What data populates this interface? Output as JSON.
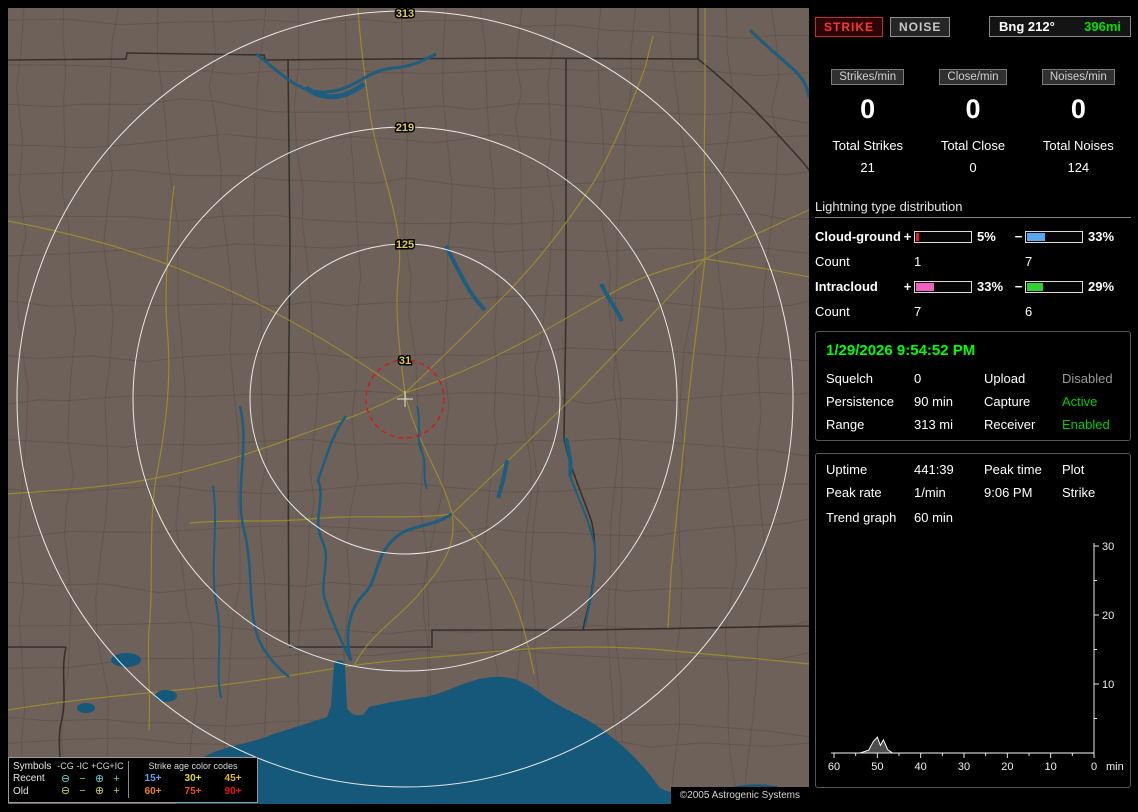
{
  "map": {
    "ring_labels": [
      "31",
      "125",
      "219",
      "313"
    ],
    "copyright": "©2005 Astrogenic Systems",
    "legend": {
      "symbols_header": "Symbols",
      "column_headers": [
        "-CG",
        "-IC",
        "+CG",
        "+IC"
      ],
      "age_header": "Strike age color codes",
      "rows": [
        {
          "label": "Recent",
          "symbols": [
            "⊖",
            "−",
            "⊕",
            "+"
          ],
          "symbol_color": "#5fd3cb",
          "ages": [
            {
              "label": "15+",
              "color": "#6a9ce8"
            },
            {
              "label": "30+",
              "color": "#d8d838"
            },
            {
              "label": "45+",
              "color": "#e8b030"
            }
          ]
        },
        {
          "label": "Old",
          "symbols": [
            "⊖",
            "−",
            "⊕",
            "+"
          ],
          "symbol_color": "#cfcf45",
          "ages": [
            {
              "label": "60+",
              "color": "#f08020"
            },
            {
              "label": "75+",
              "color": "#f05010"
            },
            {
              "label": "90+",
              "color": "#f01010"
            }
          ]
        }
      ]
    }
  },
  "panel": {
    "strike_button": "STRIKE",
    "noise_button": "NOISE",
    "bearing_label": "Bng 212°",
    "bearing_distance": "396mi",
    "bearing_distance_color": "#00e000",
    "rates": [
      {
        "label": "Strikes/min",
        "value": "0",
        "total_label": "Total Strikes",
        "total_value": "21"
      },
      {
        "label": "Close/min",
        "value": "0",
        "total_label": "Total Close",
        "total_value": "0"
      },
      {
        "label": "Noises/min",
        "value": "0",
        "total_label": "Total Noises",
        "total_value": "124"
      }
    ],
    "distribution": {
      "title": "Lightning type distribution",
      "plus_sign": "+",
      "minus_sign": "−",
      "rows": [
        {
          "label": "Cloud-ground",
          "count_label": "Count",
          "plus_pct": 5,
          "plus_pct_text": "5%",
          "plus_color": "#e02020",
          "plus_count": "1",
          "minus_pct": 33,
          "minus_pct_text": "33%",
          "minus_color": "#58a8f0",
          "minus_count": "7"
        },
        {
          "label": "Intracloud",
          "count_label": "Count",
          "plus_pct": 33,
          "plus_pct_text": "33%",
          "plus_color": "#f060c0",
          "plus_count": "7",
          "minus_pct": 29,
          "minus_pct_text": "29%",
          "minus_color": "#30d030",
          "minus_count": "6"
        }
      ]
    },
    "status": {
      "datetime": "1/29/2026 9:54:52 PM",
      "rows": [
        {
          "l1": "Squelch",
          "v1": "0",
          "l2": "Upload",
          "v2": "Disabled",
          "v2_color": "#9a9a9a"
        },
        {
          "l1": "Persistence",
          "v1": "90 min",
          "l2": "Capture",
          "v2": "Active",
          "v2_color": "#00cc00"
        },
        {
          "l1": "Range",
          "v1": "313 mi",
          "l2": "Receiver",
          "v2": "Enabled",
          "v2_color": "#00cc00"
        }
      ]
    },
    "stats": {
      "uptime_label": "Uptime",
      "uptime": "441:39",
      "peak_time_label": "Peak time",
      "plot_label": "Plot",
      "peak_rate_label": "Peak rate",
      "peak_rate": "1/min",
      "peak_time": "9:06 PM",
      "plot_value": "Strike",
      "trend_label": "Trend graph",
      "trend_value": "60 min"
    },
    "trend_graph": {
      "type": "line",
      "x_max": 60,
      "y_max": 30,
      "x_ticks": [
        60,
        50,
        40,
        30,
        20,
        10,
        0
      ],
      "y_ticks": [
        10,
        20,
        30
      ],
      "x_unit": "min",
      "series": [
        {
          "name": "strike rate",
          "points": [
            [
              60,
              0
            ],
            [
              54,
              0
            ],
            [
              52,
              0.4
            ],
            [
              51,
              1.6
            ],
            [
              50,
              2.3
            ],
            [
              49.3,
              1.1
            ],
            [
              48.6,
              1.9
            ],
            [
              47.6,
              0.5
            ],
            [
              46.5,
              0
            ],
            [
              0,
              0
            ]
          ]
        }
      ]
    }
  }
}
